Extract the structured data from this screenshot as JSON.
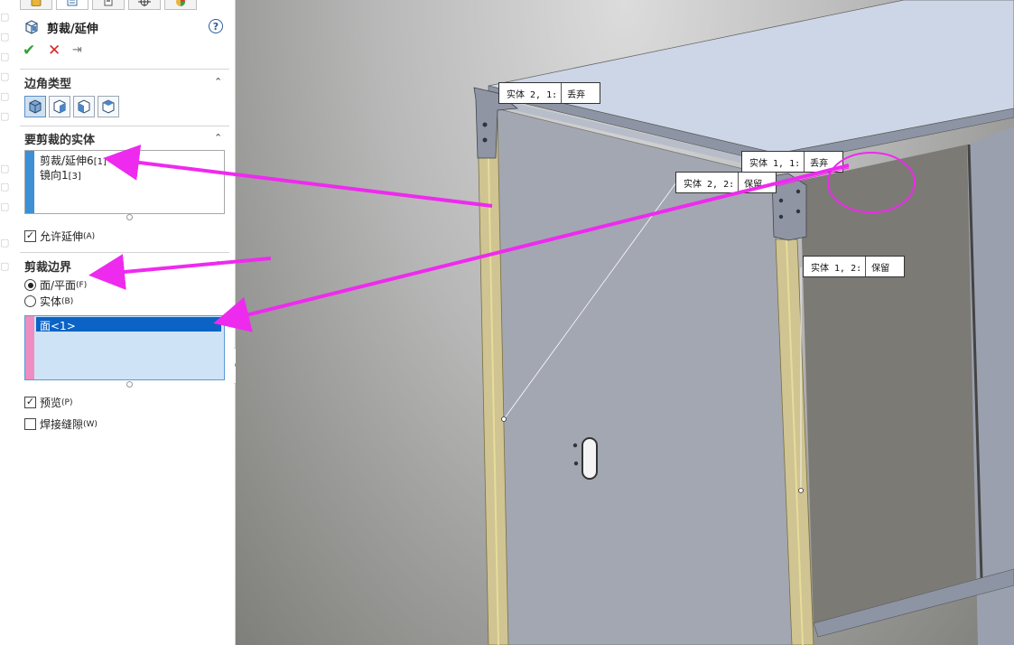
{
  "panel": {
    "title": "剪裁/延伸",
    "help_glyph": "?",
    "ok_glyph": "✔",
    "cancel_glyph": "✕",
    "pin_glyph": "⇥",
    "corner_section": {
      "title": "边角类型",
      "caret": "⌃"
    },
    "bodies_section": {
      "title": "要剪裁的实体",
      "caret": "⌃",
      "items": [
        {
          "name": "剪裁/延伸6",
          "suffix": "[1]"
        },
        {
          "name": "镜向1",
          "suffix": "[3]"
        }
      ],
      "allow_extend": {
        "label": "允许延伸",
        "shortcut": "(A)",
        "checked": true
      }
    },
    "boundary_section": {
      "title": "剪裁边界",
      "caret": "⌃",
      "options": [
        {
          "label": "面/平面",
          "shortcut": "(F)",
          "selected": true
        },
        {
          "label": "实体",
          "shortcut": "(B)",
          "selected": false
        }
      ],
      "faces": [
        "面<1>"
      ],
      "preview": {
        "label": "预览",
        "shortcut": "(P)",
        "checked": true
      },
      "weld_gap": {
        "label": "焊接缝隙",
        "shortcut": "(W)",
        "checked": false
      }
    }
  },
  "callouts": [
    {
      "body": "实体 2, 1:",
      "state": "丢弃"
    },
    {
      "body": "实体 1, 1:",
      "state": "丢弃"
    },
    {
      "body": "实体 2, 2:",
      "state": "保留"
    },
    {
      "body": "实体 1, 2:",
      "state": "保留"
    }
  ],
  "colors": {
    "accent_blue": "#3d8fd6",
    "accent_pink": "#ee8dc1",
    "annotation_magenta": "#ee2aee",
    "selection_blue": "#0b63c5",
    "list_bg": "#cfe3f6"
  }
}
